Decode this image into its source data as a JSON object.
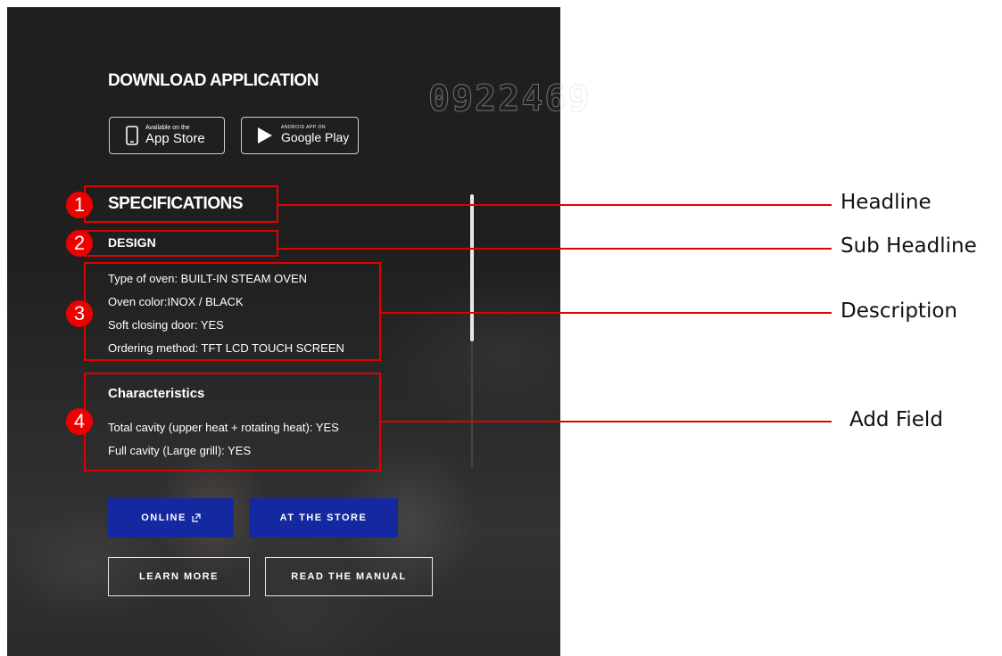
{
  "download": {
    "title": "DOWNLOAD APPLICATION",
    "app_store": {
      "small": "Available on the",
      "big": "App Store",
      "icon": "phone-icon"
    },
    "google_play": {
      "small": "ANDROID APP ON",
      "big": "Google Play",
      "icon": "play-triangle-icon"
    }
  },
  "watermark": "0922469",
  "specs": {
    "title": "SPECIFICATIONS",
    "subtitle": "DESIGN",
    "description": [
      "Type of oven: BUILT-IN STEAM OVEN",
      "Oven color:INOX / BLACK",
      "Soft closing door: YES",
      "Ordering method: TFT LCD TOUCH SCREEN"
    ],
    "characteristics_title": "Characteristics",
    "characteristics": [
      "Total cavity (upper heat + rotating heat): YES",
      "Full cavity (Large grill): YES"
    ]
  },
  "buttons": {
    "online": "ONLINE",
    "online_icon": "external-link-icon",
    "store": "AT THE STORE",
    "learn": "LEARN MORE",
    "manual": "READ THE MANUAL"
  },
  "annotations": {
    "badges": [
      "1",
      "2",
      "3",
      "4"
    ],
    "labels": [
      "Headline",
      "Sub Headline",
      "Description",
      "Add Field"
    ],
    "color": "#e00000"
  },
  "colors": {
    "panel": "#1f1f1f",
    "primary_button": "#1428a0"
  }
}
